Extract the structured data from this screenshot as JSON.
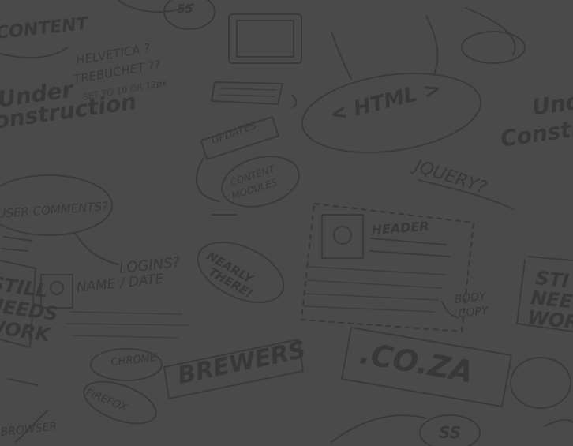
{
  "sketch": {
    "top_left": [
      "CONTENT",
      "55"
    ],
    "fonts_note": [
      "HELVETICA ?",
      "TREBUCHET ??",
      "SET TO 10 OR 12px"
    ],
    "under_construction_left": [
      "Under",
      "Construction"
    ],
    "under_construction_right": [
      "Unde",
      "Constr"
    ],
    "html_tag": "< HTML >",
    "updates": "UPDATES",
    "content_modules": [
      "CONTENT",
      "MODULES"
    ],
    "jquery": "JQUERY?",
    "user_comments": "USER COMMENTS?",
    "logins": "LOGINS?",
    "name_date": "NAME / DATE",
    "nearly_there": [
      "NEARLY",
      "THERE!"
    ],
    "header": "HEADER",
    "body_copy": [
      "BODY",
      "COPY"
    ],
    "still_needs_work_left": [
      "STILL",
      "NEEDS",
      "WORK"
    ],
    "still_needs_work_right": [
      "STI",
      "NEE",
      "WOR"
    ],
    "chrome": "CHROME",
    "firefox": "FIREFOX",
    "browsers": "BREWERS",
    "co_za": ".CO.ZA",
    "browser": "BROWSER",
    "ss_bottom": "SS"
  }
}
